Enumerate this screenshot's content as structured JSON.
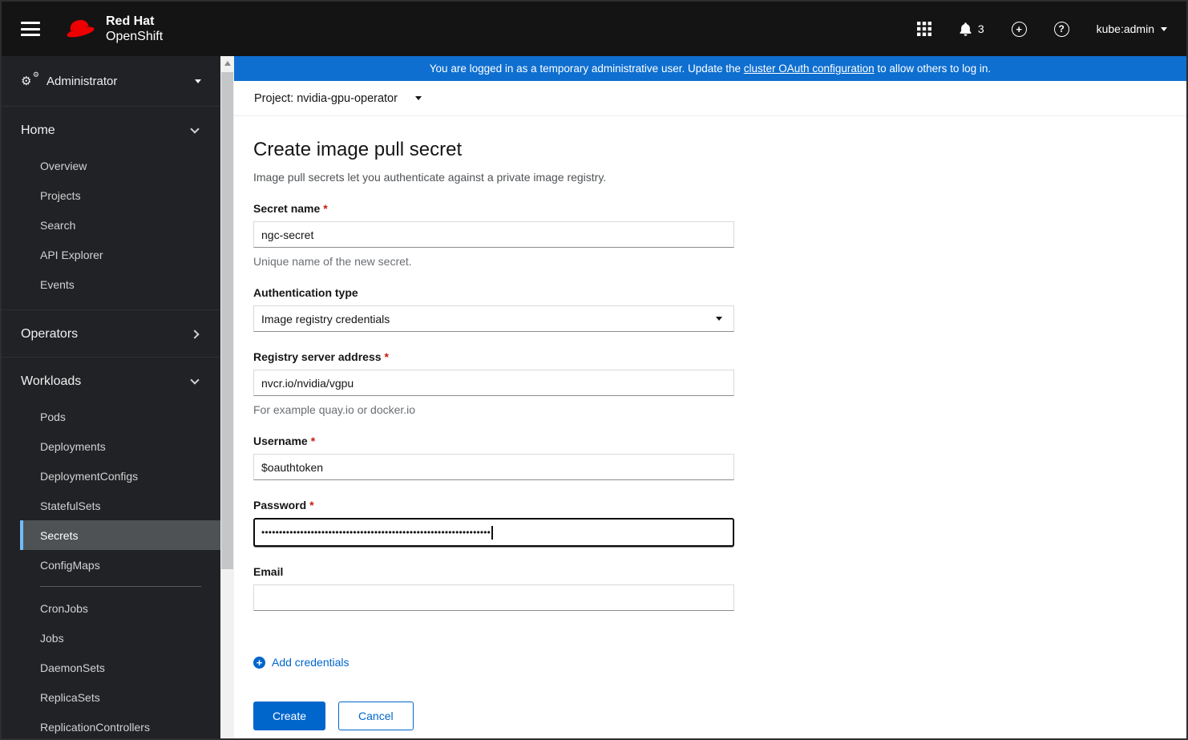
{
  "masthead": {
    "brand_line1": "Red Hat",
    "brand_line2": "OpenShift",
    "notification_count": "3",
    "user": "kube:admin"
  },
  "icons": {
    "cogs_glyph": "⚙",
    "cogs_glyph_small": "⚙",
    "plus_glyph": "+",
    "help_glyph": "?",
    "app_launcher": "grid-3x3",
    "bell": "notification-bell",
    "fedora": "red-hat-logo"
  },
  "banner": {
    "text_before": "You are logged in as a temporary administrative user. Update the ",
    "link_text": "cluster OAuth configuration",
    "text_after": " to allow others to log in."
  },
  "project_bar": {
    "label": "Project:",
    "value": "nvidia-gpu-operator"
  },
  "sidebar": {
    "perspective": "Administrator",
    "home": {
      "label": "Home",
      "items": [
        "Overview",
        "Projects",
        "Search",
        "API Explorer",
        "Events"
      ]
    },
    "operators": {
      "label": "Operators"
    },
    "workloads": {
      "label": "Workloads",
      "selected": "Secrets",
      "items_a": [
        "Pods",
        "Deployments",
        "DeploymentConfigs",
        "StatefulSets",
        "Secrets",
        "ConfigMaps"
      ],
      "items_b": [
        "CronJobs",
        "Jobs",
        "DaemonSets",
        "ReplicaSets",
        "ReplicationControllers"
      ]
    }
  },
  "form": {
    "title": "Create image pull secret",
    "subtitle": "Image pull secrets let you authenticate against a private image registry.",
    "required_marker": "*",
    "fields": {
      "secret_name": {
        "label": "Secret name",
        "value": "ngc-secret",
        "help": "Unique name of the new secret."
      },
      "auth_type": {
        "label": "Authentication type",
        "value": "Image registry credentials"
      },
      "registry": {
        "label": "Registry server address",
        "value": "nvcr.io/nvidia/vgpu",
        "help": "For example quay.io or docker.io"
      },
      "username": {
        "label": "Username",
        "value": "$oauthtoken"
      },
      "password": {
        "label": "Password",
        "value": "•••••••••••••••••••••••••••••••••••••••••••••••••••••••••••••••••"
      },
      "email": {
        "label": "Email",
        "value": ""
      }
    },
    "add_credentials_label": "Add credentials",
    "create_label": "Create",
    "cancel_label": "Cancel"
  },
  "colors": {
    "banner_blue": "#0e6fd0",
    "primary_blue": "#0066cc",
    "selected_nav_bg": "#4f5255",
    "selected_nav_border": "#73bcf7",
    "required_red": "#c9190b",
    "masthead_bg": "#141414",
    "sidebar_bg": "#202225"
  }
}
